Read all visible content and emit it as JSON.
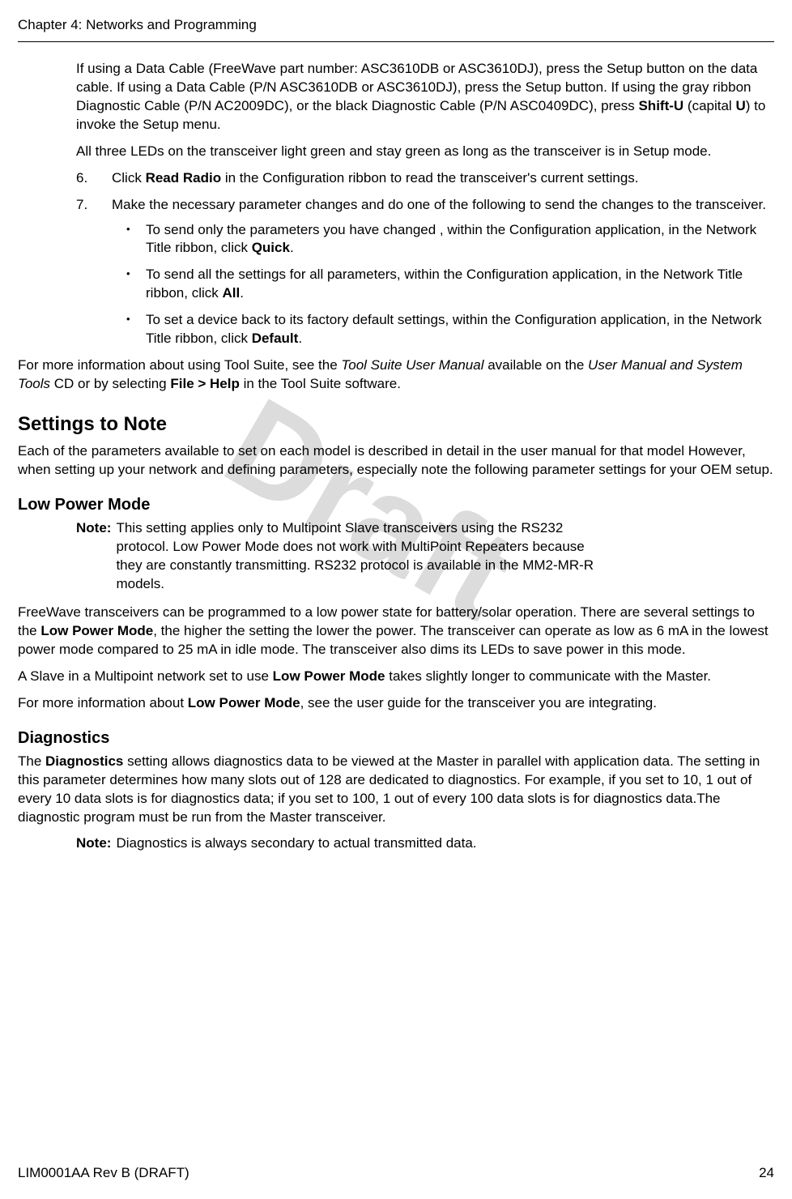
{
  "header": {
    "chapter": "Chapter 4: Networks and Programming"
  },
  "watermark": "Draft",
  "content": {
    "intro1_pre": "If using a Data Cable (FreeWave part number: ASC3610DB or ASC3610DJ), press the Setup button on the data cable. If using a Data Cable (P/N ASC3610DB or ASC3610DJ), press the Setup button. If using the gray ribbon Diagnostic Cable (P/N AC2009DC), or the black Diagnostic Cable (P/N ASC0409DC), press ",
    "intro1_b1": "Shift-U",
    "intro1_mid": " (capital ",
    "intro1_b2": "U",
    "intro1_post": ") to invoke the Setup menu.",
    "intro2": "All three LEDs on the transceiver light green and stay green as long as the transceiver is in Setup mode.",
    "step6_num": "6.",
    "step6_pre": "Click ",
    "step6_b": "Read Radio",
    "step6_post": " in the Configuration ribbon to read the transceiver's current settings.",
    "step7_num": "7.",
    "step7_text": "Make the necessary parameter changes and do one of the following to send the changes to the transceiver.",
    "bullet1_pre": "To send only the parameters you have changed , within the Configuration application, in the Network Title ribbon, click ",
    "bullet1_b": "Quick",
    "bullet1_post": ".",
    "bullet2_pre": "To send all the settings for all parameters, within the Configuration application, in the Network Title ribbon, click ",
    "bullet2_b": "All",
    "bullet2_post": ".",
    "bullet3_pre": "To set a device back to its factory default settings, within the Configuration application, in the Network Title ribbon, click ",
    "bullet3_b": "Default",
    "bullet3_post": ".",
    "moreinfo_pre": "For more information about using Tool Suite, see the ",
    "moreinfo_i1": "Tool Suite User Manual",
    "moreinfo_mid": " available on the ",
    "moreinfo_i2": "User Manual and System Tools",
    "moreinfo_mid2": " CD or by selecting ",
    "moreinfo_b": "File > Help",
    "moreinfo_post": " in the Tool Suite software.",
    "settings_heading": "Settings to Note",
    "settings_intro": "Each of the parameters available to set on each model is described in detail in the user manual for that model However, when setting up your network and defining parameters, especially note the following parameter settings for your OEM setup.",
    "lpm_heading": "Low Power Mode",
    "lpm_note_label": "Note:",
    "lpm_note_text": "This setting applies only to Multipoint Slave transceivers using the RS232 protocol. Low Power Mode does not work with MultiPoint Repeaters because they are constantly transmitting. RS232 protocol is available in the MM2-MR-R models.",
    "lpm_p1_pre": "FreeWave transceivers can be programmed to a low power state for battery/solar operation. There are several settings to the ",
    "lpm_p1_b": "Low Power Mode",
    "lpm_p1_post": ", the higher the setting the lower the power. The transceiver can operate as low as 6 mA in the lowest power mode compared to 25 mA in idle mode. The transceiver also dims its LEDs to save power in this mode.",
    "lpm_p2_pre": "A Slave in a Multipoint network set to use ",
    "lpm_p2_b": "Low Power Mode",
    "lpm_p2_post": " takes slightly longer to communicate with the Master.",
    "lpm_p3_pre": "For more information about ",
    "lpm_p3_b": "Low Power Mode",
    "lpm_p3_post": ", see the user guide for the transceiver you are integrating.",
    "diag_heading": "Diagnostics",
    "diag_p1_pre": "The ",
    "diag_p1_b": "Diagnostics",
    "diag_p1_post": " setting allows diagnostics data to be viewed at the Master in parallel with application data. The setting in this parameter determines how many slots out of 128 are dedicated to diagnostics. For example, if you set to 10, 1 out of every 10 data slots is for diagnostics data; if you set to 100, 1 out of every 100 data slots is for diagnostics data.The diagnostic program must be run from the Master transceiver.",
    "diag_note_label": "Note:",
    "diag_note_text": "Diagnostics is always secondary to actual transmitted data."
  },
  "footer": {
    "left": "LIM0001AA Rev B (DRAFT)",
    "right": "24"
  }
}
